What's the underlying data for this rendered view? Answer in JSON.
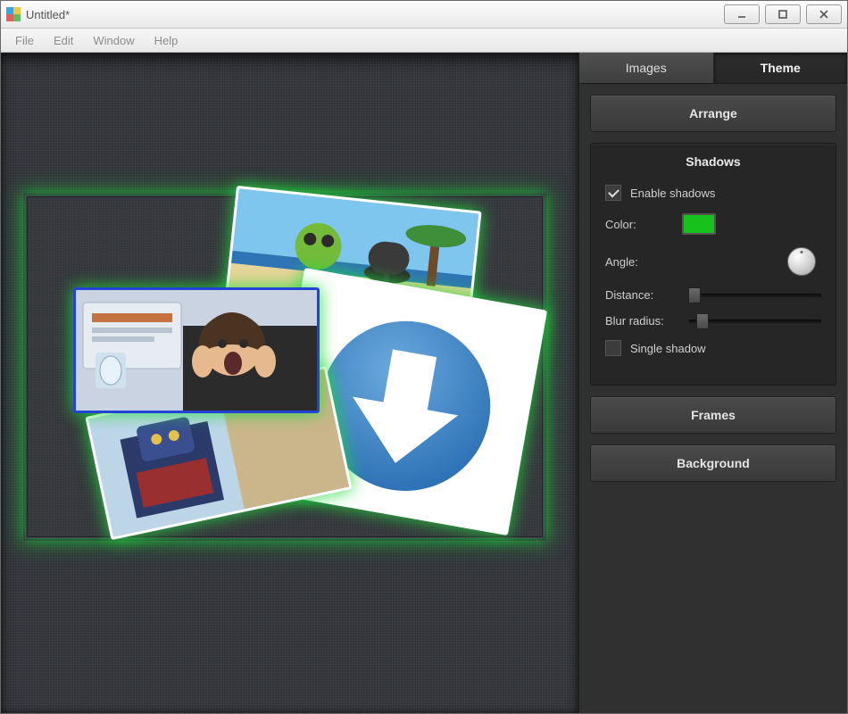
{
  "window": {
    "title": "Untitled*"
  },
  "menu": {
    "file": "File",
    "edit": "Edit",
    "window": "Window",
    "help": "Help"
  },
  "tabs": {
    "images": "Images",
    "theme": "Theme"
  },
  "panel": {
    "arrange": "Arrange",
    "shadows_title": "Shadows",
    "enable_shadows": "Enable shadows",
    "enable_shadows_checked": true,
    "color_label": "Color:",
    "shadow_color": "#17c21d",
    "angle_label": "Angle:",
    "distance_label": "Distance:",
    "distance_pct": 4,
    "blur_label": "Blur radius:",
    "blur_pct": 10,
    "single_shadow": "Single shadow",
    "single_shadow_checked": false,
    "frames": "Frames",
    "background": "Background"
  },
  "canvas": {
    "images": [
      {
        "id": "beach",
        "kind": "beach-scene"
      },
      {
        "id": "scream",
        "kind": "surprised-boy"
      },
      {
        "id": "robot",
        "kind": "robot-figure"
      },
      {
        "id": "arrow",
        "kind": "download-arrow"
      }
    ]
  }
}
